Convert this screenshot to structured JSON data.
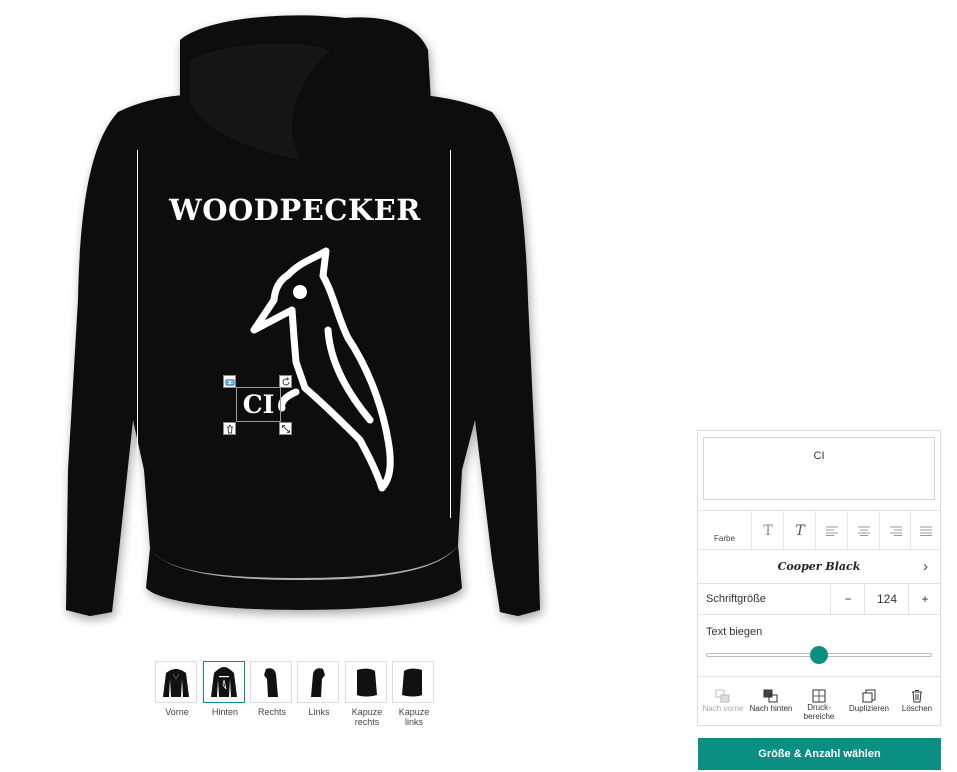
{
  "product": {
    "print_text": "WOODPECKER",
    "selected_text": "CI"
  },
  "thumbnails": [
    {
      "label": "Vorne",
      "active": false
    },
    {
      "label": "Hinten",
      "active": true
    },
    {
      "label": "Rechts",
      "active": false
    },
    {
      "label": "Links",
      "active": false
    },
    {
      "label": "Kapuze rechts",
      "active": false
    },
    {
      "label": "Kapuze links",
      "active": false
    }
  ],
  "editor": {
    "text_value": "CI",
    "color_label": "Farbe",
    "font_name": "Cooper Black",
    "size_label": "Schriftgröße",
    "size_minus": "−",
    "size_value": "124",
    "size_plus": "+",
    "curve_label": "Text biegen",
    "curve_value": 0.5,
    "layers": {
      "forward": "Nach vorne",
      "backward": "Nach hinten",
      "print_area": "Druck-\nbereiche",
      "duplicate": "Duplizieren",
      "delete": "Löschen"
    }
  },
  "cta_label": "Größe & Anzahl wählen",
  "colors": {
    "accent": "#0b8f83",
    "hoodie": "#0d0d0d",
    "print": "#ffffff"
  }
}
